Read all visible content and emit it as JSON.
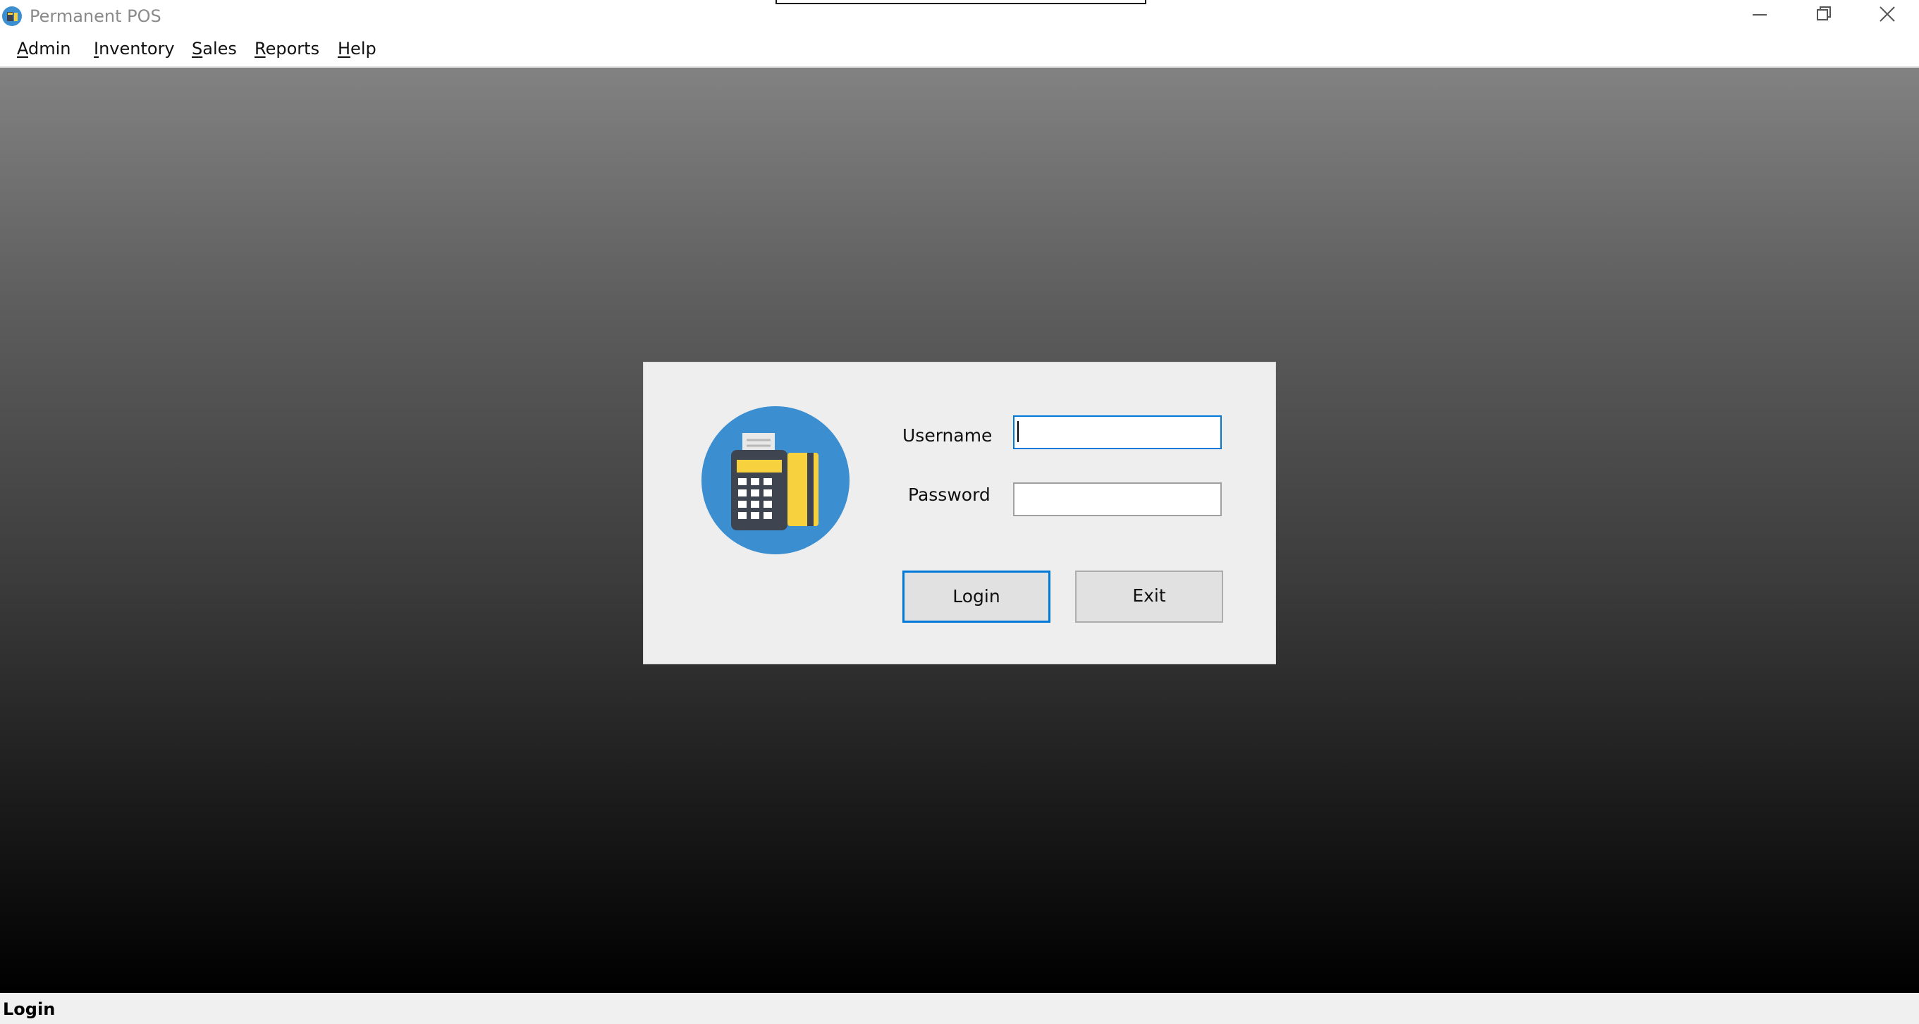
{
  "window": {
    "title": "Permanent POS",
    "app_icon": "pos-app-icon",
    "controls": [
      "minimize-icon",
      "restore-icon",
      "close-icon"
    ]
  },
  "menubar": {
    "items": [
      {
        "accel": "A",
        "rest": "dmin"
      },
      {
        "accel": "I",
        "rest": "nventory"
      },
      {
        "accel": "S",
        "rest": "ales"
      },
      {
        "accel": "R",
        "rest": "eports"
      },
      {
        "accel": "H",
        "rest": "elp"
      }
    ]
  },
  "login": {
    "icon": "pos-terminal-icon",
    "username_label": "Username",
    "username_value": "",
    "password_label": "Password",
    "password_value": "",
    "login_button": "Login",
    "exit_button": "Exit"
  },
  "status": {
    "text": "Login"
  },
  "colors": {
    "accent": "#0078d7",
    "icon_circle": "#3b8fd1",
    "icon_yellow": "#f7d23e",
    "icon_dark": "#3e4550"
  }
}
